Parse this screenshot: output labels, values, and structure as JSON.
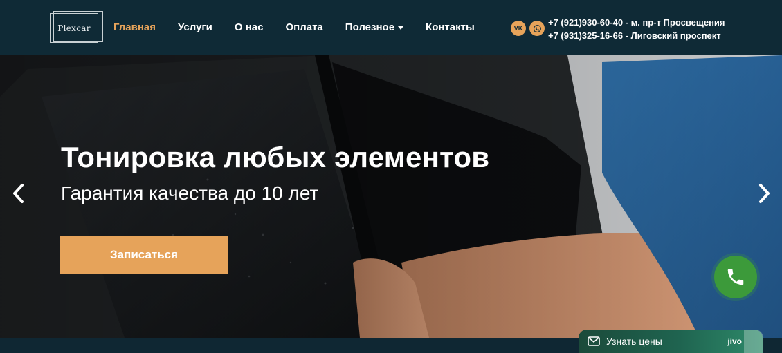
{
  "logo": {
    "text": "Plexcar"
  },
  "nav": {
    "items": [
      {
        "label": "Главная",
        "active": true
      },
      {
        "label": "Услуги"
      },
      {
        "label": "О нас"
      },
      {
        "label": "Оплата"
      },
      {
        "label": "Полезное",
        "has_dropdown": true
      },
      {
        "label": "Контакты"
      }
    ]
  },
  "social": {
    "icons": [
      "vk-icon",
      "whatsapp-icon"
    ],
    "vk_text": "VK",
    "color": "#e6a35a"
  },
  "contacts": {
    "phone1": "+7 (921)930-60-40 - м. пр-т Просвещения",
    "phone2": "+7 (931)325-16-66 - Лиговский проспект"
  },
  "hero": {
    "title": "Тонировка любых элементов",
    "subtitle": "Гарантия качества до 10 лет",
    "cta_label": "Записаться"
  },
  "chat": {
    "label": "Узнать цены",
    "brand": "jivo"
  },
  "colors": {
    "accent": "#e6a35a",
    "header_bg": "#0f2a36",
    "call_button": "#3c9a3a"
  }
}
